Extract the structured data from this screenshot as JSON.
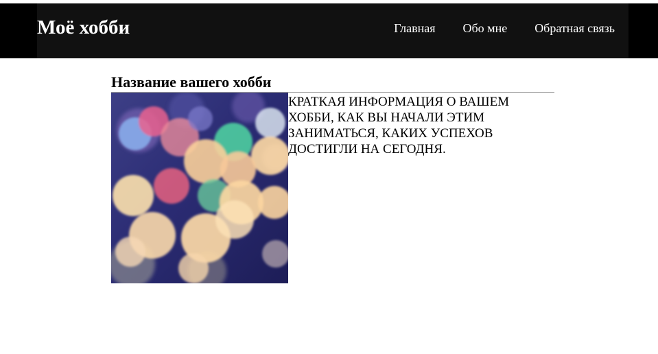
{
  "header": {
    "site_title": "Моё хобби",
    "nav": [
      {
        "label": "Главная"
      },
      {
        "label": "Обо мне"
      },
      {
        "label": "Обратная связь"
      }
    ]
  },
  "main": {
    "hobby_title": "Название вашего хобби",
    "hobby_description": "КРАТКАЯ ИНФОРМАЦИЯ О ВАШЕМ ХОББИ, КАК ВЫ НАЧАЛИ ЭТИМ ЗАНИМАТЬСЯ, КАКИХ УСПЕХОВ ДОСТИГЛИ НА СЕГОДНЯ."
  },
  "colors": {
    "header_background": "#111111",
    "page_background": "#ffffff",
    "text": "#000000"
  }
}
